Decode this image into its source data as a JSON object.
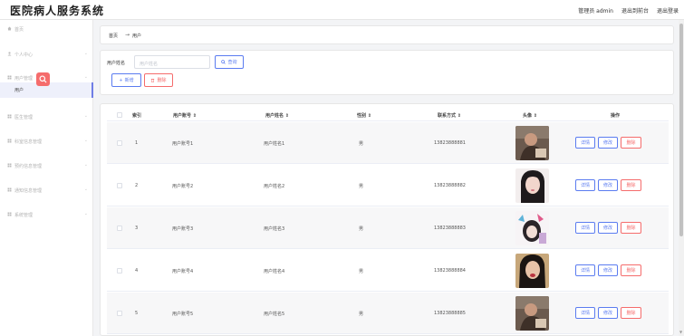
{
  "app": {
    "title": "医院病人服务系统"
  },
  "header": {
    "admin_label": "管理员 admin",
    "front_label": "退出到前台",
    "logout_label": "退出登录"
  },
  "sidebar": {
    "items": [
      {
        "label": "首页",
        "icon": "home-icon"
      },
      {
        "label": "个人中心",
        "icon": "user-icon"
      },
      {
        "label": "用户管理",
        "icon": "grid-icon"
      },
      {
        "label": "医生管理",
        "icon": "grid-icon"
      },
      {
        "label": "科室信息管理",
        "icon": "grid-icon"
      },
      {
        "label": "预约信息管理",
        "icon": "grid-icon"
      },
      {
        "label": "通知信息管理",
        "icon": "grid-icon"
      },
      {
        "label": "系统管理",
        "icon": "grid-icon"
      }
    ],
    "active_sub": "用户"
  },
  "breadcrumb": {
    "home": "首页",
    "sep": "→",
    "current": "用户"
  },
  "filter": {
    "label": "用户姓名",
    "placeholder": "用户姓名",
    "query_label": "查询",
    "add_label": "新增",
    "delete_label": "删除"
  },
  "table": {
    "headers": {
      "index": "索引",
      "account": "用户账号",
      "name": "用户姓名",
      "gender": "性别",
      "phone": "联系方式",
      "avatar": "头像",
      "actions": "操作"
    },
    "rows": [
      {
        "index": "1",
        "account": "用户账号1",
        "name": "用户姓名1",
        "gender": "男",
        "phone": "13823888881"
      },
      {
        "index": "2",
        "account": "用户账号2",
        "name": "用户姓名2",
        "gender": "男",
        "phone": "13823888882"
      },
      {
        "index": "3",
        "account": "用户账号3",
        "name": "用户姓名3",
        "gender": "男",
        "phone": "13823888883"
      },
      {
        "index": "4",
        "account": "用户账号4",
        "name": "用户姓名4",
        "gender": "男",
        "phone": "13823888884"
      },
      {
        "index": "5",
        "account": "用户账号5",
        "name": "用户姓名5",
        "gender": "男",
        "phone": "13823888885"
      }
    ],
    "action_labels": {
      "detail": "详情",
      "edit": "修改",
      "delete": "删除"
    }
  },
  "colors": {
    "primary": "#5b7cf0",
    "danger": "#f56c6c",
    "active_bg": "#eef0fb"
  }
}
